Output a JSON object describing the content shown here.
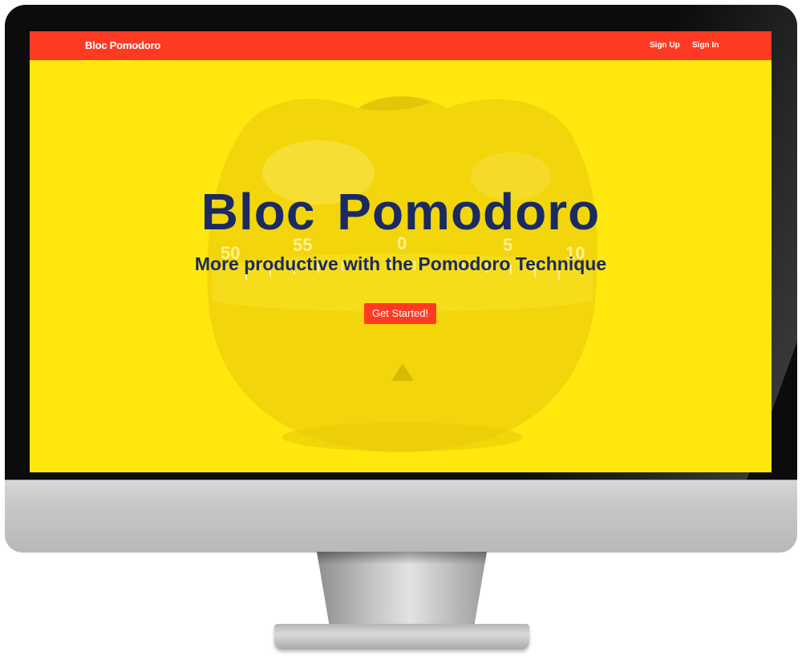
{
  "navbar": {
    "brand": "Bloc Pomodoro",
    "links": [
      {
        "label": "Sign Up"
      },
      {
        "label": "Sign In"
      }
    ]
  },
  "hero": {
    "title": "Bloc Pomodoro",
    "subtitle": "More productive with the Pomodoro Technique",
    "cta_label": "Get Started!",
    "dial_numbers": [
      "50",
      "55",
      "0",
      "5",
      "10"
    ]
  },
  "colors": {
    "navbar": "#ff3a23",
    "background": "#ffe80d",
    "text": "#1a2a63",
    "button": "#ff3a23"
  }
}
